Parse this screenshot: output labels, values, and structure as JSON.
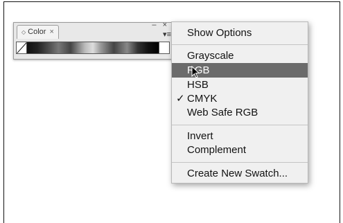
{
  "panel": {
    "tab_arrows": "◇",
    "tab_label": "Color",
    "tab_close": "×",
    "window_controls": "– ×",
    "menu_button": "▾≡"
  },
  "menu": {
    "items": [
      {
        "label": "Show Options"
      },
      {
        "label": "Grayscale"
      },
      {
        "label": "RGB",
        "selected": true
      },
      {
        "label": "HSB"
      },
      {
        "label": "CMYK",
        "checked": true
      },
      {
        "label": "Web Safe RGB"
      },
      {
        "label": "Invert"
      },
      {
        "label": "Complement"
      },
      {
        "label": "Create New Swatch..."
      }
    ],
    "check_glyph": "✓"
  }
}
